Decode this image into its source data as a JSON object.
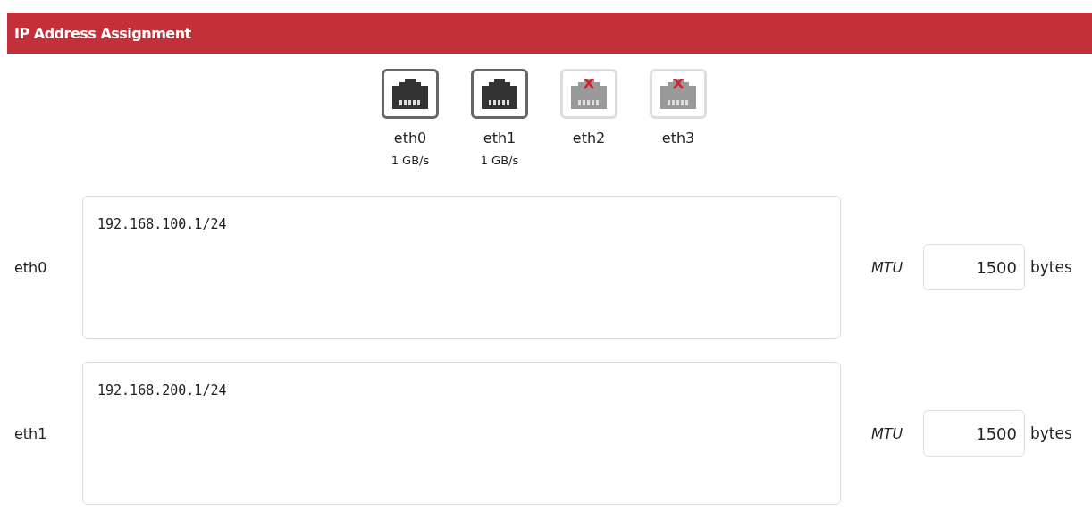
{
  "section": {
    "title": "IP Address Assignment"
  },
  "ports": [
    {
      "name": "eth0",
      "connected": true,
      "speed": "1 GB/s"
    },
    {
      "name": "eth1",
      "connected": true,
      "speed": "1 GB/s"
    },
    {
      "name": "eth2",
      "connected": false
    },
    {
      "name": "eth3",
      "connected": false
    }
  ],
  "interfaces": [
    {
      "label": "eth0",
      "addresses": "192.168.100.1/24",
      "mtu_label": "MTU",
      "mtu": "1500",
      "unit": "bytes"
    },
    {
      "label": "eth1",
      "addresses": "192.168.200.1/24",
      "mtu_label": "MTU",
      "mtu": "1500",
      "unit": "bytes"
    }
  ]
}
